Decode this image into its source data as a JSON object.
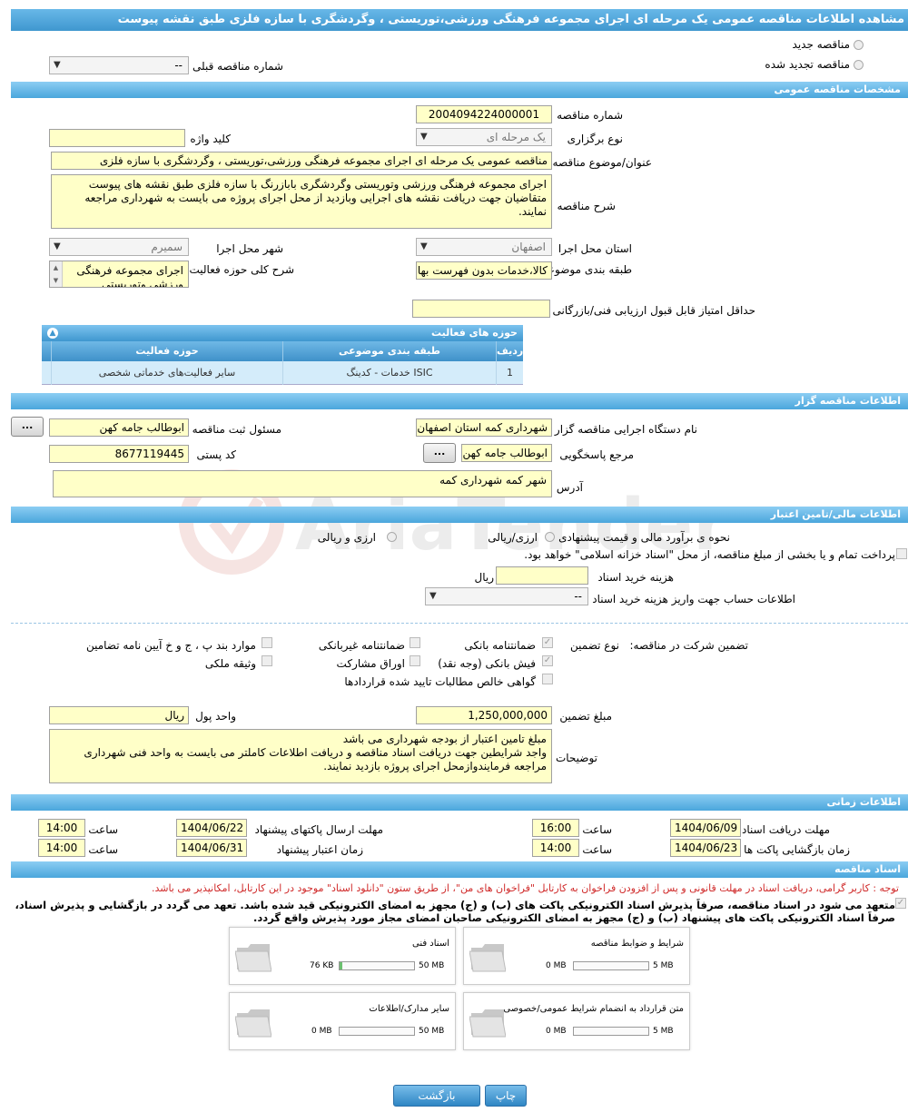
{
  "title": "مشاهده اطلاعات مناقصه عمومی یک مرحله ای اجرای مجموعه فرهنگی ورزشی،توریستی ، وگردشگری با سازه فلزی طبق نقشه پیوست",
  "top": {
    "new_tender": "مناقصه جدید",
    "renewed_tender": "مناقصه تجدید شده",
    "prev_number_label": "شماره مناقصه قبلی",
    "prev_number_value": "--"
  },
  "sections": {
    "general": "مشخصات مناقصه عمومی",
    "organizer": "اطلاعات مناقصه گزار",
    "finance": "اطلاعات مالی/تامین اعتبار",
    "timing": "اطلاعات زمانی",
    "docs": "اسناد مناقصه"
  },
  "general": {
    "number_label": "شماره مناقصه",
    "number_value": "2004094224000001",
    "type_label": "نوع برگزاری",
    "type_value": "یک مرحله ای",
    "keyword_label": "کلید واژه",
    "keyword_value": "",
    "subject_label": "عنوان/موضوع مناقصه",
    "subject_value": "مناقصه عمومی یک مرحله ای اجرای مجموعه فرهنگی ورزشی،توریستی ، وگردشگری  با سازه فلزی",
    "desc_label": "شرح مناقصه",
    "desc_value": "اجرای مجموعه فرهنگی ورزشی  وتوریستی وگردشگری بابازرنگ با سازه فلزی طبق نقشه های  پیوست متقاضیان جهت دریافت نقشه های اجرایی  وبازدید از محل اجرای پروژه می بایست به شهرداری مراجعه نمایند.",
    "province_label": "استان محل اجرا",
    "province_value": "اصفهان",
    "city_label": "شهر محل اجرا",
    "city_value": "سمیرم",
    "category_label": "طبقه بندی موضوعی",
    "category_value": "کالا،خدمات بدون فهرست بها",
    "activity_desc_label": "شرح کلی حوزه فعالیت",
    "activity_desc_value": "اجرای مجموعه فرهنگی ورزشی  وتوریستی",
    "min_score_label": "حداقل امتیاز قابل قبول ارزیابی فنی/بازرگانی",
    "min_score_value": ""
  },
  "activity_grid": {
    "title": "حوزه های فعالیت",
    "headers": [
      "ردیف",
      "طبقه بندی موضوعی",
      "حوزه فعالیت"
    ],
    "rows": [
      {
        "row": "1",
        "category": "خدمات - کدینگ ISIC",
        "field": "سایر فعالیت‌های خدماتی شخصی"
      }
    ]
  },
  "organizer": {
    "org_label": "نام دستگاه اجرایی مناقصه گزار",
    "org_value": "شهرداری کمه استان اصفهان",
    "registrar_label": "مسئول ثبت مناقصه",
    "registrar_value": "ابوطالب جامه کهن",
    "contact_label": "مرجع پاسخگویی",
    "contact_value": "ابوطالب جامه کهن",
    "postal_label": "کد پستی",
    "postal_value": "8677119445",
    "address_label": "آدرس",
    "address_value": "شهر کمه شهرداری کمه",
    "dots": "..."
  },
  "finance": {
    "estimate_label": "نحوه ی برآورد مالی و قیمت پیشنهادی",
    "opt_currency_rial": "ارزی/ریالی",
    "opt_currency_and_rial": "ارزی و ریالی",
    "treasury_text": "پرداخت تمام و یا بخشی از مبلغ مناقصه، از محل \"اسناد خزانه اسلامی\" خواهد بود.",
    "doc_cost_label": "هزینه خرید اسناد",
    "doc_cost_value": "",
    "rial": "ریال",
    "account_label": "اطلاعات حساب جهت واریز هزینه خرید اسناد",
    "account_value": "--",
    "guarantee_label": "تضمین شرکت در مناقصه:",
    "guarantee_type_label": "نوع تضمین",
    "g_bank": "ضمانتنامه بانکی",
    "g_nonbank": "ضمانتنامه غیربانکی",
    "g_items": "موارد بند پ ، ج و خ آیین نامه تضامین",
    "g_cash": "فیش بانکی (وجه نقد)",
    "g_bonds": "اوراق مشارکت",
    "g_property": "وثیقه ملکی",
    "g_cert": "گواهی خالص مطالبات تایید شده قراردادها",
    "amount_label": "مبلغ تضمین",
    "amount_value": "1,250,000,000",
    "currency_label": "واحد پول",
    "currency_value": "ریال",
    "notes_label": "توضیحات",
    "notes_value": "مبلغ تامین اعتبار از بودجه شهرداری می باشد\nواجد شرایطین جهت دریافت اسناد مناقصه و دریافت اطلاعات کاملتر می بایست به واحد فنی شهرداری مراجعه فرمایندوازمحل اجرای پروژه بازدید نمایند."
  },
  "timing": {
    "doc_receive_label": "مهلت دریافت اسناد",
    "doc_receive_date": "1404/06/09",
    "doc_receive_time": "16:00",
    "send_label": "مهلت ارسال پاکتهای پیشنهاد",
    "send_date": "1404/06/22",
    "send_time": "14:00",
    "open_label": "زمان بازگشایی پاکت ها",
    "open_date": "1404/06/23",
    "open_time": "14:00",
    "validity_label": "زمان اعتبار پیشنهاد",
    "validity_date": "1404/06/31",
    "validity_time": "14:00",
    "hour": "ساعت"
  },
  "docs": {
    "notice": "توجه : کاربر گرامی، دریافت اسناد در مهلت قانونی و پس از افزودن فراخوان به کارتابل \"فراخوان های من\"، از طریق ستون \"دانلود اسناد\" موجود در این کارتابل، امکانپذیر می باشد.",
    "commit1": "متعهد می شود در اسناد مناقصه، صرفاً پذیرش اسناد الکترونیکی پاکت های (ب) و (ج) مجهز به امضای الکترونیکی قید شده باشد. تعهد می گردد در بازگشایی و پذیرش اسناد،",
    "commit2": "صرفاً اسناد الکترونیکی پاکت های پیشنهاد (ب) و (ج) مجهز به امضای الکترونیکی صاحبان امضای مجاز مورد پذیرش واقع گردد.",
    "files": [
      {
        "name": "شرایط و ضوابط مناقصه",
        "used": "0 MB",
        "max": "5 MB",
        "fill": 0
      },
      {
        "name": "اسناد فنی",
        "used": "76 KB",
        "max": "50 MB",
        "fill": 0.02
      },
      {
        "name": "متن قرارداد به انضمام شرایط عمومی/خصوصی",
        "used": "0 MB",
        "max": "5 MB",
        "fill": 0
      },
      {
        "name": "سایر مدارک/اطلاعات",
        "used": "0 MB",
        "max": "50 MB",
        "fill": 0
      }
    ]
  },
  "buttons": {
    "print": "چاپ",
    "back": "بازگشت"
  },
  "watermark": "AriaTender.neT",
  "colors": {
    "header_blue": "#3f97cf",
    "field_yellow": "#ffffc8",
    "notice_red": "#d02a2a"
  }
}
